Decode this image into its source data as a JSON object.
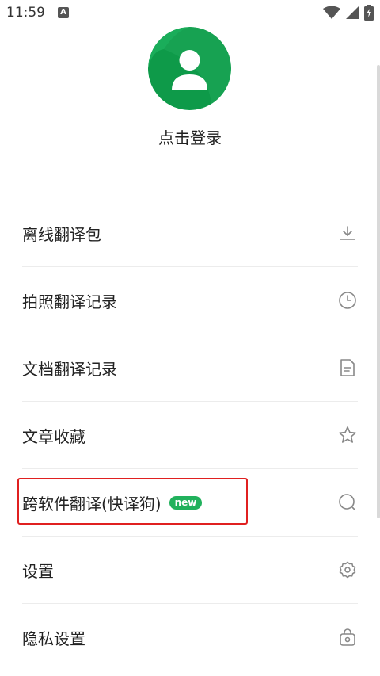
{
  "status_bar": {
    "time": "11:59",
    "notification_icon": "a-icon",
    "wifi_icon": "wifi-icon",
    "signal_icon": "signal-icon",
    "battery_icon": "battery-charging-icon"
  },
  "profile": {
    "avatar_icon": "user-avatar-icon",
    "login_label": "点击登录",
    "accent_color": "#1aad5a"
  },
  "menu": {
    "items": [
      {
        "label": "离线翻译包",
        "icon": "download-icon"
      },
      {
        "label": "拍照翻译记录",
        "icon": "clock-icon"
      },
      {
        "label": "文档翻译记录",
        "icon": "document-icon"
      },
      {
        "label": "文章收藏",
        "icon": "star-icon"
      },
      {
        "label": "跨软件翻译(快译狗)",
        "badge": "new",
        "icon": "search-icon"
      },
      {
        "label": "设置",
        "icon": "gear-icon"
      },
      {
        "label": "隐私设置",
        "icon": "lock-icon"
      }
    ]
  }
}
